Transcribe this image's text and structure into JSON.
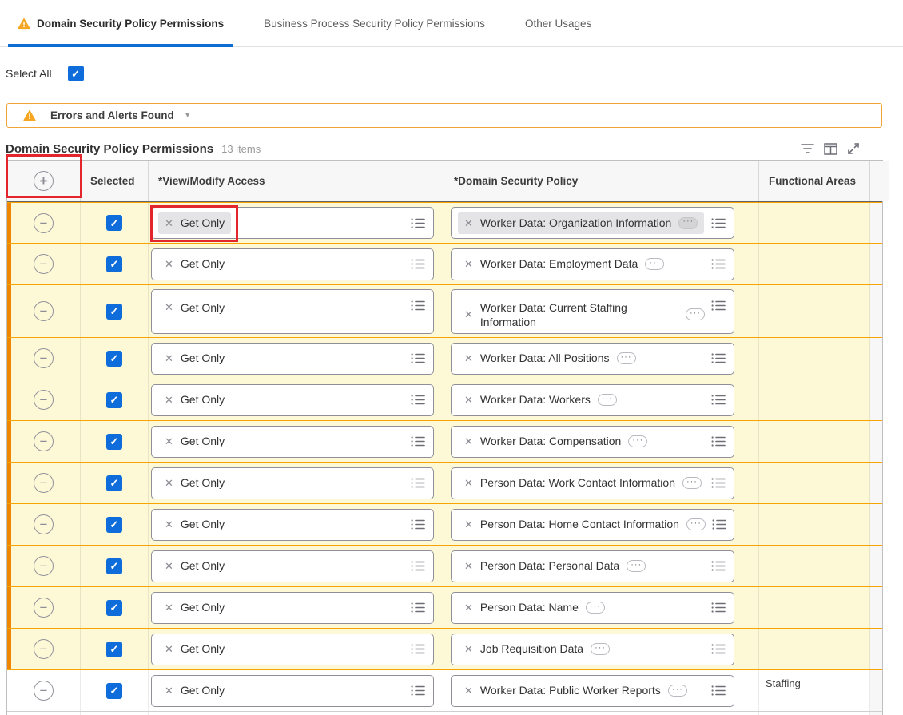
{
  "tabs": [
    {
      "label": "Domain Security Policy Permissions",
      "active": true,
      "warning": true
    },
    {
      "label": "Business Process Security Policy Permissions",
      "active": false
    },
    {
      "label": "Other Usages",
      "active": false
    }
  ],
  "select_all": {
    "label": "Select All",
    "checked": true
  },
  "alert_banner": {
    "label": "Errors and Alerts Found",
    "caret": "▼"
  },
  "section": {
    "title": "Domain Security Policy Permissions",
    "count": "13 items"
  },
  "toolbar": {
    "icons": [
      "filter-icon",
      "grid-view-icon",
      "expand-icon"
    ]
  },
  "table": {
    "headers": {
      "selected": "Selected",
      "access": "*View/Modify Access",
      "policy": "*Domain Security Policy",
      "functional": "Functional Areas"
    },
    "token_remove_glyph": "✕",
    "ellipsis_glyph": "···",
    "rows": [
      {
        "selected": true,
        "access": "Get Only",
        "policy": "Worker Data: Organization Information",
        "functional": "",
        "highlight": true,
        "state": "selected"
      },
      {
        "selected": true,
        "access": "Get Only",
        "policy": "Worker Data: Employment Data",
        "functional": "",
        "highlight": true
      },
      {
        "selected": true,
        "access": "Get Only",
        "policy": "Worker Data: Current Staffing Information",
        "functional": "",
        "highlight": true,
        "tall": true
      },
      {
        "selected": true,
        "access": "Get Only",
        "policy": "Worker Data: All Positions",
        "functional": "",
        "highlight": true
      },
      {
        "selected": true,
        "access": "Get Only",
        "policy": "Worker Data: Workers",
        "functional": "",
        "highlight": true
      },
      {
        "selected": true,
        "access": "Get Only",
        "policy": "Worker Data: Compensation",
        "functional": "",
        "highlight": true
      },
      {
        "selected": true,
        "access": "Get Only",
        "policy": "Person Data: Work Contact Information",
        "functional": "",
        "highlight": true
      },
      {
        "selected": true,
        "access": "Get Only",
        "policy": "Person Data: Home Contact Information",
        "functional": "",
        "highlight": true
      },
      {
        "selected": true,
        "access": "Get Only",
        "policy": "Person Data: Personal Data",
        "functional": "",
        "highlight": true
      },
      {
        "selected": true,
        "access": "Get Only",
        "policy": "Person Data: Name",
        "functional": "",
        "highlight": true
      },
      {
        "selected": true,
        "access": "Get Only",
        "policy": "Job Requisition Data",
        "functional": "",
        "highlight": true
      },
      {
        "selected": true,
        "access": "Get Only",
        "policy": "Worker Data: Public Worker Reports",
        "functional": "Staffing",
        "highlight": false
      }
    ]
  },
  "colors": {
    "accent_blue": "#0b6ed0",
    "checkbox_blue": "#0f6ddb",
    "warning_orange": "#f5a623",
    "row_highlight_yellow": "#fdf8d6",
    "row_stripe_orange": "#ee8600",
    "row_separator_orange": "#f5a400",
    "annotation_red": "#e3252c"
  }
}
